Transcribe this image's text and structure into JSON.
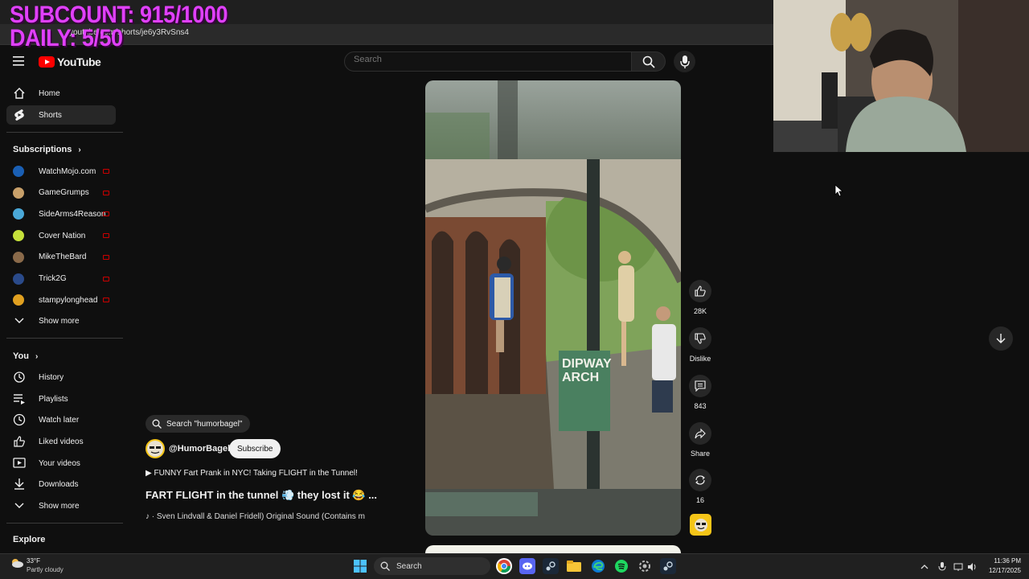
{
  "overlay": {
    "subcount": "SUBCOUNT: 915/1000",
    "daily": "DAILY: 5/50"
  },
  "browser": {
    "url": "youtube.com/shorts/je6y3RvSns4"
  },
  "header": {
    "logo_text": "YouTube",
    "search_placeholder": "Search"
  },
  "sidebar": {
    "main": [
      {
        "label": "Home",
        "icon": "home-icon"
      },
      {
        "label": "Shorts",
        "icon": "shorts-icon"
      }
    ],
    "subscriptions_title": "Subscriptions",
    "subscriptions": [
      {
        "label": "WatchMojo.com",
        "color": "#1a5fb4"
      },
      {
        "label": "GameGrumps",
        "color": "#c8a06a"
      },
      {
        "label": "SideArms4Reason",
        "color": "#4aa8d8"
      },
      {
        "label": "Cover Nation",
        "color": "#c5e03a"
      },
      {
        "label": "MikeTheBard",
        "color": "#8a6a4a"
      },
      {
        "label": "Trick2G",
        "color": "#2a4a8a"
      },
      {
        "label": "stampylonghead",
        "color": "#e0a020"
      }
    ],
    "show_more": "Show more",
    "you_title": "You",
    "you_items": [
      {
        "label": "History",
        "icon": "history-icon"
      },
      {
        "label": "Playlists",
        "icon": "playlists-icon"
      },
      {
        "label": "Watch later",
        "icon": "watch-later-icon"
      },
      {
        "label": "Liked videos",
        "icon": "liked-icon"
      },
      {
        "label": "Your videos",
        "icon": "your-videos-icon"
      },
      {
        "label": "Downloads",
        "icon": "downloads-icon"
      }
    ],
    "show_more_2": "Show more",
    "explore_title": "Explore"
  },
  "short": {
    "search_chip": "Search \"humorbagel\"",
    "channel": "@HumorBagel",
    "subscribe": "Subscribe",
    "description": "▶ FUNNY Fart Prank in NYC! Taking FLIGHT in the Tunnel!",
    "title": "FART FLIGHT in the tunnel 💨 they lost it 😂 ...",
    "sound": "♪ · Sven Lindvall & Daniel Fridell)    Original Sound (Contains m",
    "sign_text_1": "DIPWAY",
    "sign_text_2": "ARCH"
  },
  "actions": {
    "likes": "28K",
    "dislike": "Dislike",
    "comments": "843",
    "share": "Share",
    "remix": "16"
  },
  "taskbar": {
    "weather_temp": "33°F",
    "weather_desc": "Partly cloudy",
    "search": "Search",
    "time": "11:36 PM",
    "date": "12/17/2025"
  },
  "colors": {
    "accent": "#ff0000",
    "overlay": "#e040fb"
  }
}
